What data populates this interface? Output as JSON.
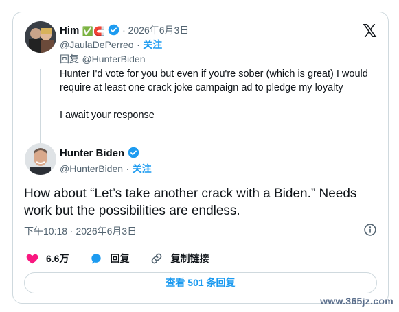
{
  "reply_tweet": {
    "display_name": "Him",
    "name_emojis": "✅🧲",
    "timestamp": "· 2026年6月3日",
    "handle": "@JaulaDePerreo",
    "dot": "·",
    "follow_label": "关注",
    "replying_prefix": "回复",
    "replying_to": "@HunterBiden",
    "text_line1": "Hunter I'd vote for you but even if you're sober (which is great) I would require at least one crack joke campaign ad to pledge my loyalty",
    "text_line2": "I await your response"
  },
  "main_tweet": {
    "display_name": "Hunter Biden",
    "handle": "@HunterBiden",
    "dot": "·",
    "follow_label": "关注",
    "text": "How about “Let’s take another crack with a Biden.” Needs work but the possibilities are endless.",
    "time": "下午10:18 · 2026年6月3日"
  },
  "actions": {
    "likes": "6.6万",
    "reply_label": "回复",
    "copy_link_label": "复制链接"
  },
  "read_replies_label": "查看 501 条回复",
  "watermark": "www.365jz.com",
  "colors": {
    "accent": "#1d9bf0",
    "like": "#f91880",
    "muted": "#536471",
    "border": "#cfd9de"
  },
  "icons": [
    "x-logo-icon",
    "verified-badge-icon",
    "info-icon",
    "heart-icon",
    "reply-bubble-icon",
    "link-icon"
  ]
}
